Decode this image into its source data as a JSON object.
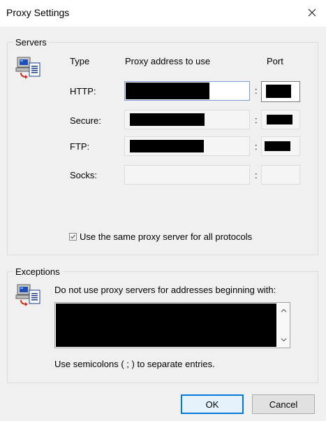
{
  "dialog": {
    "title": "Proxy Settings"
  },
  "servers": {
    "group_label": "Servers",
    "headers": {
      "type": "Type",
      "address": "Proxy address to use",
      "port": "Port"
    },
    "rows": [
      {
        "label": "HTTP:"
      },
      {
        "label": "Secure:"
      },
      {
        "label": "FTP:"
      },
      {
        "label": "Socks:"
      }
    ],
    "separator": ":",
    "same_proxy_label": "Use the same proxy server for all protocols",
    "same_proxy_checked": true
  },
  "exceptions": {
    "group_label": "Exceptions",
    "description": "Do not use proxy servers for addresses beginning with:",
    "hint": "Use semicolons ( ; ) to separate entries."
  },
  "buttons": {
    "ok": "OK",
    "cancel": "Cancel"
  },
  "icons": {
    "servers": "network-computer-icon",
    "exceptions": "network-computer-icon",
    "close": "close-icon"
  }
}
